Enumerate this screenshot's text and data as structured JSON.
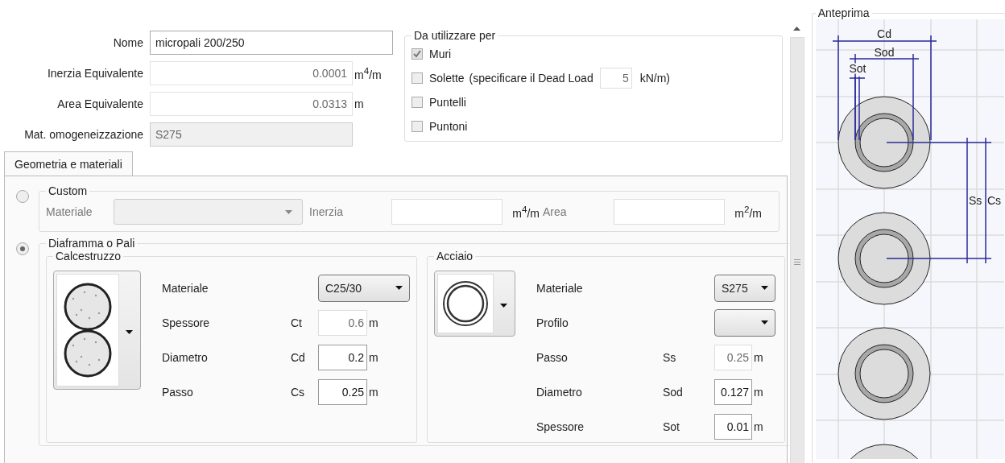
{
  "header_fields": [
    {
      "label": "Nome",
      "value": "micropali 200/250",
      "kind": "input"
    },
    {
      "label": "Inerzia Equivalente",
      "value": "0.0001",
      "unit": "m$^{4}$/m",
      "kind": "readonly"
    },
    {
      "label": "Area Equivalente",
      "value": "0.0313",
      "unit": "m",
      "kind": "readonly"
    },
    {
      "label": "Mat. omogeneizzazione",
      "value": "S275",
      "kind": "disabled"
    }
  ],
  "usage": {
    "title": "Da utilizzare per",
    "options": [
      {
        "label": "Muri",
        "checked": true,
        "disabled": true
      },
      {
        "label": "Solette",
        "checked": false,
        "disabled": false,
        "note": "(specificare il Dead Load",
        "value": "5",
        "unit": "kN/m)"
      },
      {
        "label": "Puntelli",
        "checked": false,
        "disabled": false
      },
      {
        "label": "Puntoni",
        "checked": false,
        "disabled": false
      }
    ]
  },
  "tabs": [
    {
      "label": "Geometria e materiali",
      "selected": true
    }
  ],
  "custom": {
    "title": "Custom",
    "selected": false,
    "material_label": "Materiale",
    "inertia_label": "Inerzia",
    "inertia_unit": "m$^{4}$/m",
    "area_label": "Area",
    "area_unit": "m$^{2}$/m"
  },
  "diaframma": {
    "title": "Diaframma o Pali",
    "selected": true,
    "groups": [
      {
        "title": "Calcestruzzo",
        "kind": "concrete",
        "rows": [
          {
            "label": "Materiale",
            "kind": "dropdown",
            "value": "C25/30"
          },
          {
            "label": "Spessore",
            "symbol": "Ct",
            "value": "0.6",
            "unit": "m",
            "kind": "readonly"
          },
          {
            "label": "Diametro",
            "symbol": "Cd",
            "value": "0.2",
            "unit": "m",
            "kind": "input"
          },
          {
            "label": "Passo",
            "symbol": "Cs",
            "value": "0.25",
            "unit": "m",
            "kind": "input"
          }
        ]
      },
      {
        "title": "Acciaio",
        "kind": "steel",
        "rows": [
          {
            "label": "Materiale",
            "kind": "dropdown",
            "value": "S275"
          },
          {
            "label": "Profilo",
            "kind": "dropdown"
          },
          {
            "label": "Passo",
            "symbol": "Ss",
            "value": "0.25",
            "unit": "m",
            "kind": "readonly"
          },
          {
            "label": "Diametro",
            "symbol": "Sod",
            "value": "0.127",
            "unit": "m",
            "kind": "input"
          },
          {
            "label": "Spessore",
            "symbol": "Sot",
            "value": "0.01",
            "unit": "m",
            "kind": "input"
          }
        ]
      }
    ]
  },
  "preview": {
    "title": "Anteprima",
    "dimensions": {
      "cd": "Cd",
      "sod": "Sod",
      "sot": "Sot",
      "ss": "Ss",
      "cs": "Cs"
    }
  }
}
